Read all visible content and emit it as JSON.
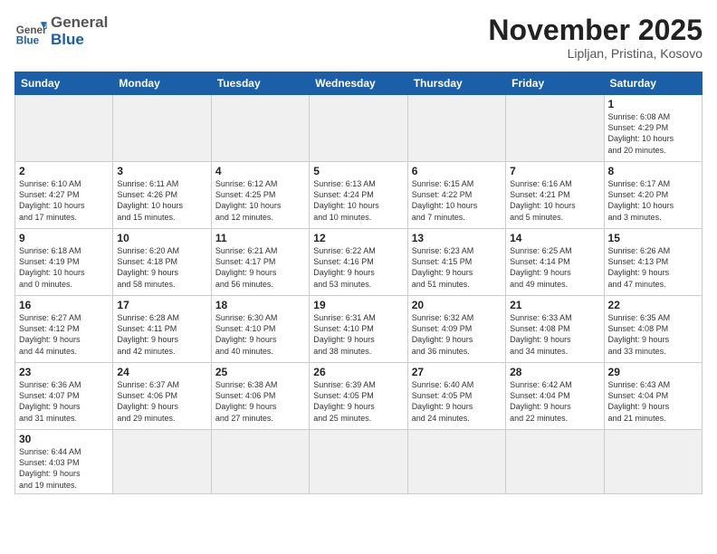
{
  "header": {
    "logo_general": "General",
    "logo_blue": "Blue",
    "month_title": "November 2025",
    "subtitle": "Lipljan, Pristina, Kosovo"
  },
  "days_of_week": [
    "Sunday",
    "Monday",
    "Tuesday",
    "Wednesday",
    "Thursday",
    "Friday",
    "Saturday"
  ],
  "weeks": [
    [
      {
        "day": "",
        "info": "",
        "empty": true
      },
      {
        "day": "",
        "info": "",
        "empty": true
      },
      {
        "day": "",
        "info": "",
        "empty": true
      },
      {
        "day": "",
        "info": "",
        "empty": true
      },
      {
        "day": "",
        "info": "",
        "empty": true
      },
      {
        "day": "",
        "info": "",
        "empty": true
      },
      {
        "day": "1",
        "info": "Sunrise: 6:08 AM\nSunset: 4:29 PM\nDaylight: 10 hours\nand 20 minutes."
      }
    ],
    [
      {
        "day": "2",
        "info": "Sunrise: 6:10 AM\nSunset: 4:27 PM\nDaylight: 10 hours\nand 17 minutes."
      },
      {
        "day": "3",
        "info": "Sunrise: 6:11 AM\nSunset: 4:26 PM\nDaylight: 10 hours\nand 15 minutes."
      },
      {
        "day": "4",
        "info": "Sunrise: 6:12 AM\nSunset: 4:25 PM\nDaylight: 10 hours\nand 12 minutes."
      },
      {
        "day": "5",
        "info": "Sunrise: 6:13 AM\nSunset: 4:24 PM\nDaylight: 10 hours\nand 10 minutes."
      },
      {
        "day": "6",
        "info": "Sunrise: 6:15 AM\nSunset: 4:22 PM\nDaylight: 10 hours\nand 7 minutes."
      },
      {
        "day": "7",
        "info": "Sunrise: 6:16 AM\nSunset: 4:21 PM\nDaylight: 10 hours\nand 5 minutes."
      },
      {
        "day": "8",
        "info": "Sunrise: 6:17 AM\nSunset: 4:20 PM\nDaylight: 10 hours\nand 3 minutes."
      }
    ],
    [
      {
        "day": "9",
        "info": "Sunrise: 6:18 AM\nSunset: 4:19 PM\nDaylight: 10 hours\nand 0 minutes."
      },
      {
        "day": "10",
        "info": "Sunrise: 6:20 AM\nSunset: 4:18 PM\nDaylight: 9 hours\nand 58 minutes."
      },
      {
        "day": "11",
        "info": "Sunrise: 6:21 AM\nSunset: 4:17 PM\nDaylight: 9 hours\nand 56 minutes."
      },
      {
        "day": "12",
        "info": "Sunrise: 6:22 AM\nSunset: 4:16 PM\nDaylight: 9 hours\nand 53 minutes."
      },
      {
        "day": "13",
        "info": "Sunrise: 6:23 AM\nSunset: 4:15 PM\nDaylight: 9 hours\nand 51 minutes."
      },
      {
        "day": "14",
        "info": "Sunrise: 6:25 AM\nSunset: 4:14 PM\nDaylight: 9 hours\nand 49 minutes."
      },
      {
        "day": "15",
        "info": "Sunrise: 6:26 AM\nSunset: 4:13 PM\nDaylight: 9 hours\nand 47 minutes."
      }
    ],
    [
      {
        "day": "16",
        "info": "Sunrise: 6:27 AM\nSunset: 4:12 PM\nDaylight: 9 hours\nand 44 minutes."
      },
      {
        "day": "17",
        "info": "Sunrise: 6:28 AM\nSunset: 4:11 PM\nDaylight: 9 hours\nand 42 minutes."
      },
      {
        "day": "18",
        "info": "Sunrise: 6:30 AM\nSunset: 4:10 PM\nDaylight: 9 hours\nand 40 minutes."
      },
      {
        "day": "19",
        "info": "Sunrise: 6:31 AM\nSunset: 4:10 PM\nDaylight: 9 hours\nand 38 minutes."
      },
      {
        "day": "20",
        "info": "Sunrise: 6:32 AM\nSunset: 4:09 PM\nDaylight: 9 hours\nand 36 minutes."
      },
      {
        "day": "21",
        "info": "Sunrise: 6:33 AM\nSunset: 4:08 PM\nDaylight: 9 hours\nand 34 minutes."
      },
      {
        "day": "22",
        "info": "Sunrise: 6:35 AM\nSunset: 4:08 PM\nDaylight: 9 hours\nand 33 minutes."
      }
    ],
    [
      {
        "day": "23",
        "info": "Sunrise: 6:36 AM\nSunset: 4:07 PM\nDaylight: 9 hours\nand 31 minutes."
      },
      {
        "day": "24",
        "info": "Sunrise: 6:37 AM\nSunset: 4:06 PM\nDaylight: 9 hours\nand 29 minutes."
      },
      {
        "day": "25",
        "info": "Sunrise: 6:38 AM\nSunset: 4:06 PM\nDaylight: 9 hours\nand 27 minutes."
      },
      {
        "day": "26",
        "info": "Sunrise: 6:39 AM\nSunset: 4:05 PM\nDaylight: 9 hours\nand 25 minutes."
      },
      {
        "day": "27",
        "info": "Sunrise: 6:40 AM\nSunset: 4:05 PM\nDaylight: 9 hours\nand 24 minutes."
      },
      {
        "day": "28",
        "info": "Sunrise: 6:42 AM\nSunset: 4:04 PM\nDaylight: 9 hours\nand 22 minutes."
      },
      {
        "day": "29",
        "info": "Sunrise: 6:43 AM\nSunset: 4:04 PM\nDaylight: 9 hours\nand 21 minutes."
      }
    ],
    [
      {
        "day": "30",
        "info": "Sunrise: 6:44 AM\nSunset: 4:03 PM\nDaylight: 9 hours\nand 19 minutes."
      },
      {
        "day": "",
        "info": "",
        "empty": true
      },
      {
        "day": "",
        "info": "",
        "empty": true
      },
      {
        "day": "",
        "info": "",
        "empty": true
      },
      {
        "day": "",
        "info": "",
        "empty": true
      },
      {
        "day": "",
        "info": "",
        "empty": true
      },
      {
        "day": "",
        "info": "",
        "empty": true
      }
    ]
  ]
}
